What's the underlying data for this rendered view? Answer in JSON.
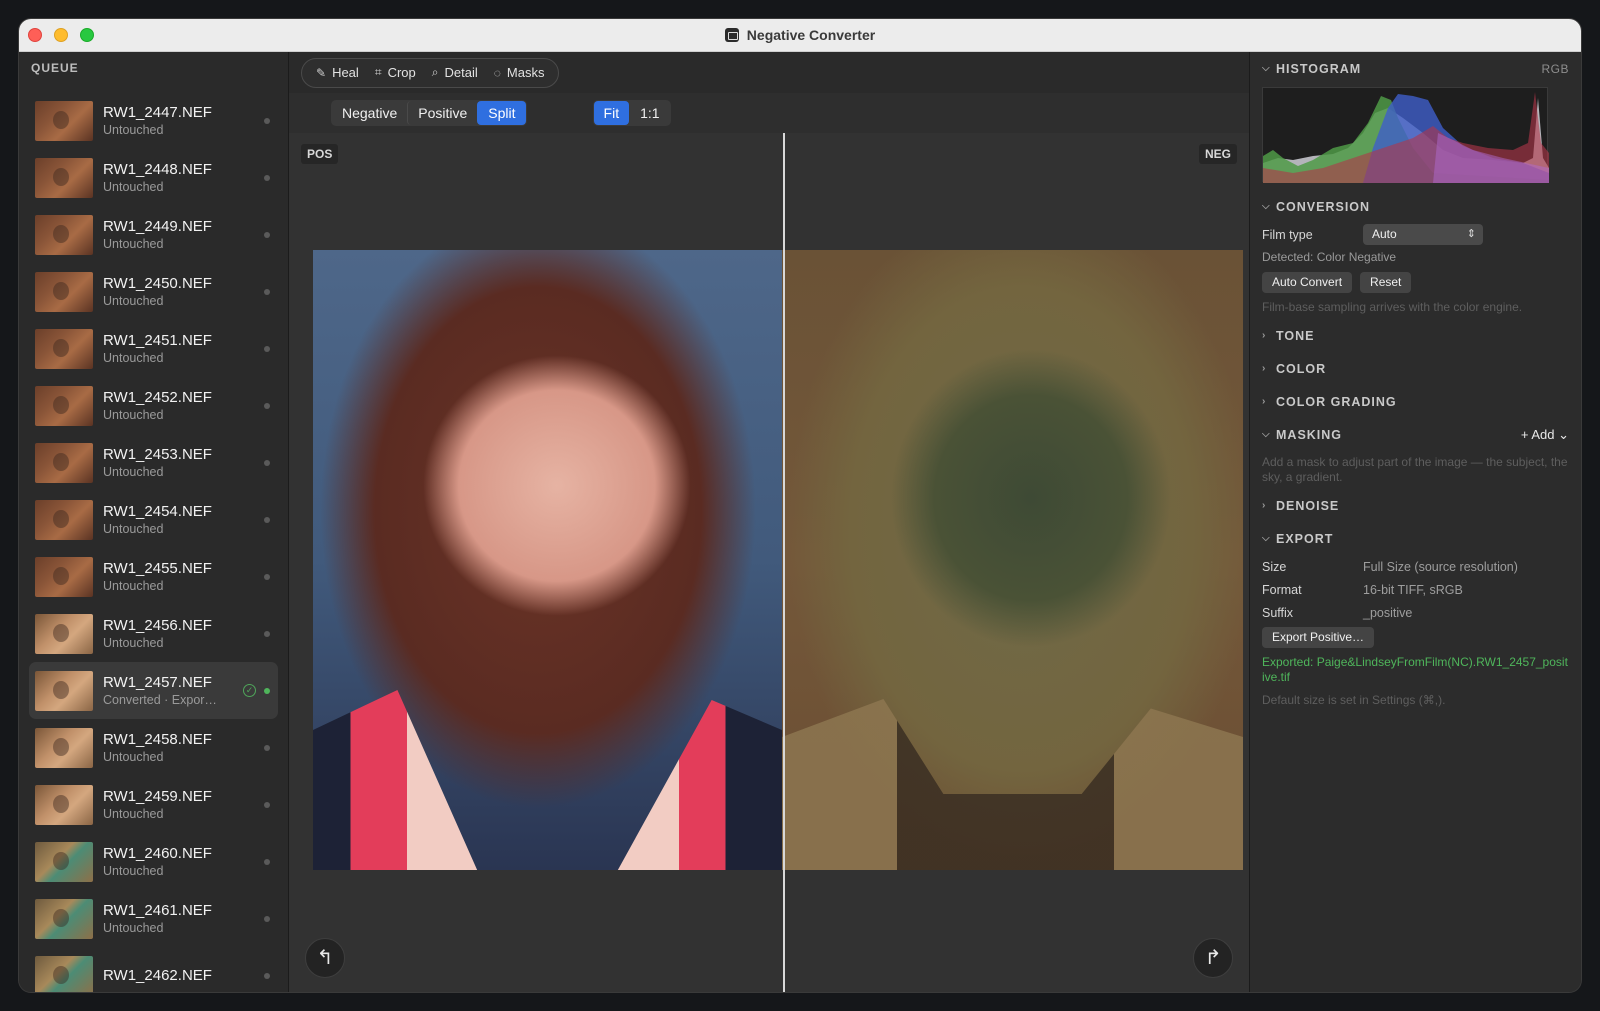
{
  "window": {
    "title": "Negative Converter"
  },
  "sidebar": {
    "header": "QUEUE",
    "items": [
      {
        "name": "RW1_2447.NEF",
        "status": "Untouched",
        "thumb": "a"
      },
      {
        "name": "RW1_2448.NEF",
        "status": "Untouched",
        "thumb": "a"
      },
      {
        "name": "RW1_2449.NEF",
        "status": "Untouched",
        "thumb": "a"
      },
      {
        "name": "RW1_2450.NEF",
        "status": "Untouched",
        "thumb": "a"
      },
      {
        "name": "RW1_2451.NEF",
        "status": "Untouched",
        "thumb": "a"
      },
      {
        "name": "RW1_2452.NEF",
        "status": "Untouched",
        "thumb": "a"
      },
      {
        "name": "RW1_2453.NEF",
        "status": "Untouched",
        "thumb": "a"
      },
      {
        "name": "RW1_2454.NEF",
        "status": "Untouched",
        "thumb": "a"
      },
      {
        "name": "RW1_2455.NEF",
        "status": "Untouched",
        "thumb": "a"
      },
      {
        "name": "RW1_2456.NEF",
        "status": "Untouched",
        "thumb": "b"
      },
      {
        "name": "RW1_2457.NEF",
        "status": "Converted · Expor…",
        "thumb": "b",
        "selected": true
      },
      {
        "name": "RW1_2458.NEF",
        "status": "Untouched",
        "thumb": "b"
      },
      {
        "name": "RW1_2459.NEF",
        "status": "Untouched",
        "thumb": "b"
      },
      {
        "name": "RW1_2460.NEF",
        "status": "Untouched",
        "thumb": "c"
      },
      {
        "name": "RW1_2461.NEF",
        "status": "Untouched",
        "thumb": "c"
      },
      {
        "name": "RW1_2462.NEF",
        "status": "",
        "thumb": "c"
      }
    ]
  },
  "toolbar": {
    "tools": [
      {
        "label": "Heal",
        "icon": "bandage-icon",
        "glyph": "✎"
      },
      {
        "label": "Crop",
        "icon": "crop-icon",
        "glyph": "⌗"
      },
      {
        "label": "Detail",
        "icon": "magnifier-icon",
        "glyph": "⌕"
      },
      {
        "label": "Masks",
        "icon": "mask-circle-icon",
        "glyph": "◌"
      }
    ],
    "view_modes": [
      "Negative",
      "Positive",
      "Split"
    ],
    "active_view_mode": "Split",
    "zoom_modes": [
      "Fit",
      "1:1"
    ],
    "active_zoom_mode": "Fit"
  },
  "viewer": {
    "pos_label": "POS",
    "neg_label": "NEG",
    "rotate_left_glyph": "↰",
    "rotate_right_glyph": "↱"
  },
  "panel": {
    "histogram": {
      "title": "HISTOGRAM",
      "mode": "RGB"
    },
    "conversion": {
      "title": "CONVERSION",
      "film_type_label": "Film type",
      "film_type_value": "Auto",
      "detected": "Detected: Color Negative",
      "auto_convert": "Auto Convert",
      "reset": "Reset",
      "hint": "Film-base sampling arrives with the color engine."
    },
    "tone": "TONE",
    "color": "COLOR",
    "color_grading": "COLOR GRADING",
    "masking": {
      "title": "MASKING",
      "add": "Add",
      "hint": "Add a mask to adjust part of the image — the subject, the sky, a gradient."
    },
    "denoise": "DENOISE",
    "export": {
      "title": "EXPORT",
      "size_label": "Size",
      "size_value": "Full Size (source resolution)",
      "format_label": "Format",
      "format_value": "16-bit TIFF, sRGB",
      "suffix_label": "Suffix",
      "suffix_value": "_positive",
      "button": "Export Positive…",
      "exported": "Exported: Paige&LindseyFromFilm(NC).RW1_2457_positive.tif",
      "hint": "Default size is set in Settings (⌘,)."
    }
  },
  "colors": {
    "accent": "#2f6fe0",
    "success": "#4fb55b"
  }
}
